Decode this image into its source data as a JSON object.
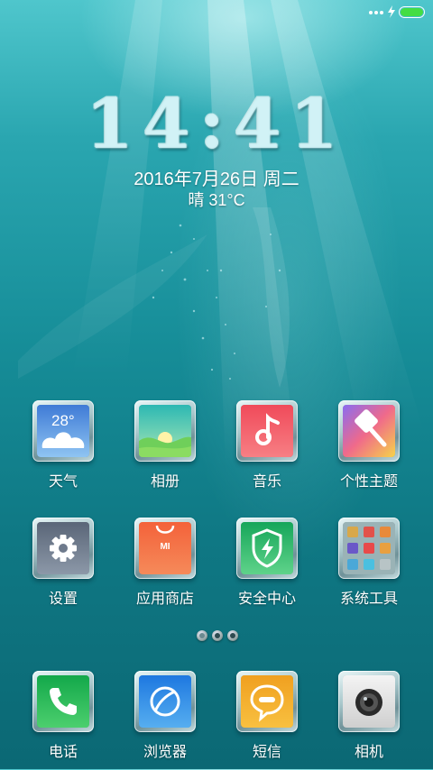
{
  "status_bar": {
    "icons": [
      "signal-dots-icon",
      "charging-icon",
      "battery-icon"
    ],
    "battery_color": "#44dd44"
  },
  "lockclock": {
    "time": "14:41",
    "date": "2016年7月26日 周二",
    "weather": "晴 31°C"
  },
  "apps": [
    {
      "label": "天气",
      "icon": "weather-icon",
      "badge": "28°"
    },
    {
      "label": "相册",
      "icon": "gallery-icon"
    },
    {
      "label": "音乐",
      "icon": "music-icon"
    },
    {
      "label": "个性主题",
      "icon": "theme-brush-icon"
    },
    {
      "label": "设置",
      "icon": "gear-icon"
    },
    {
      "label": "应用商店",
      "icon": "app-store-bag-icon",
      "badge": "MI"
    },
    {
      "label": "安全中心",
      "icon": "security-shield-icon"
    },
    {
      "label": "系统工具",
      "icon": "tools-folder-icon"
    }
  ],
  "page_indicator": {
    "count": 3,
    "active": 0
  },
  "dock": [
    {
      "label": "电话",
      "icon": "phone-icon"
    },
    {
      "label": "浏览器",
      "icon": "browser-icon"
    },
    {
      "label": "短信",
      "icon": "messaging-icon"
    },
    {
      "label": "相机",
      "icon": "camera-icon"
    }
  ]
}
